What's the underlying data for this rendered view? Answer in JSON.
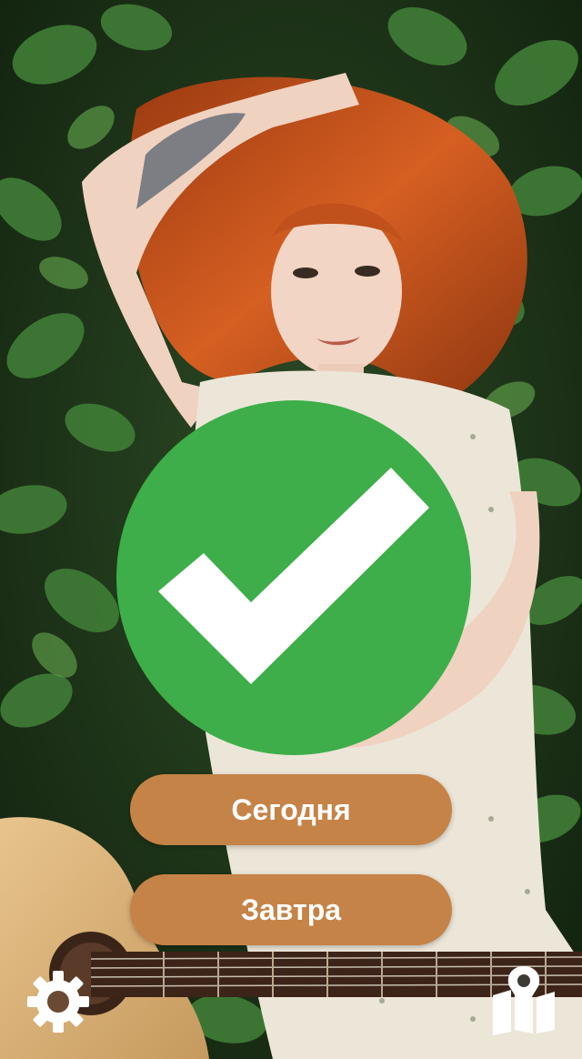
{
  "colors": {
    "check_green": "#3dae49",
    "button_bg": "#c58347",
    "foliage_dark": "#1f3a1c",
    "foliage_leaf": "#3f7a35",
    "hair": "#c5501c",
    "skin": "#f0d2c0",
    "dress": "#ece6d8",
    "guitar": "#d9b17c"
  },
  "background": {
    "icon": "photo-woman-lying-in-leaves-with-guitar"
  },
  "status": {
    "icon": "checkmark-icon"
  },
  "buttons": {
    "today_label": "Сегодня",
    "tomorrow_label": "Завтра"
  },
  "toolbar": {
    "settings_icon": "gear-icon",
    "map_icon": "map-pin-icon"
  }
}
